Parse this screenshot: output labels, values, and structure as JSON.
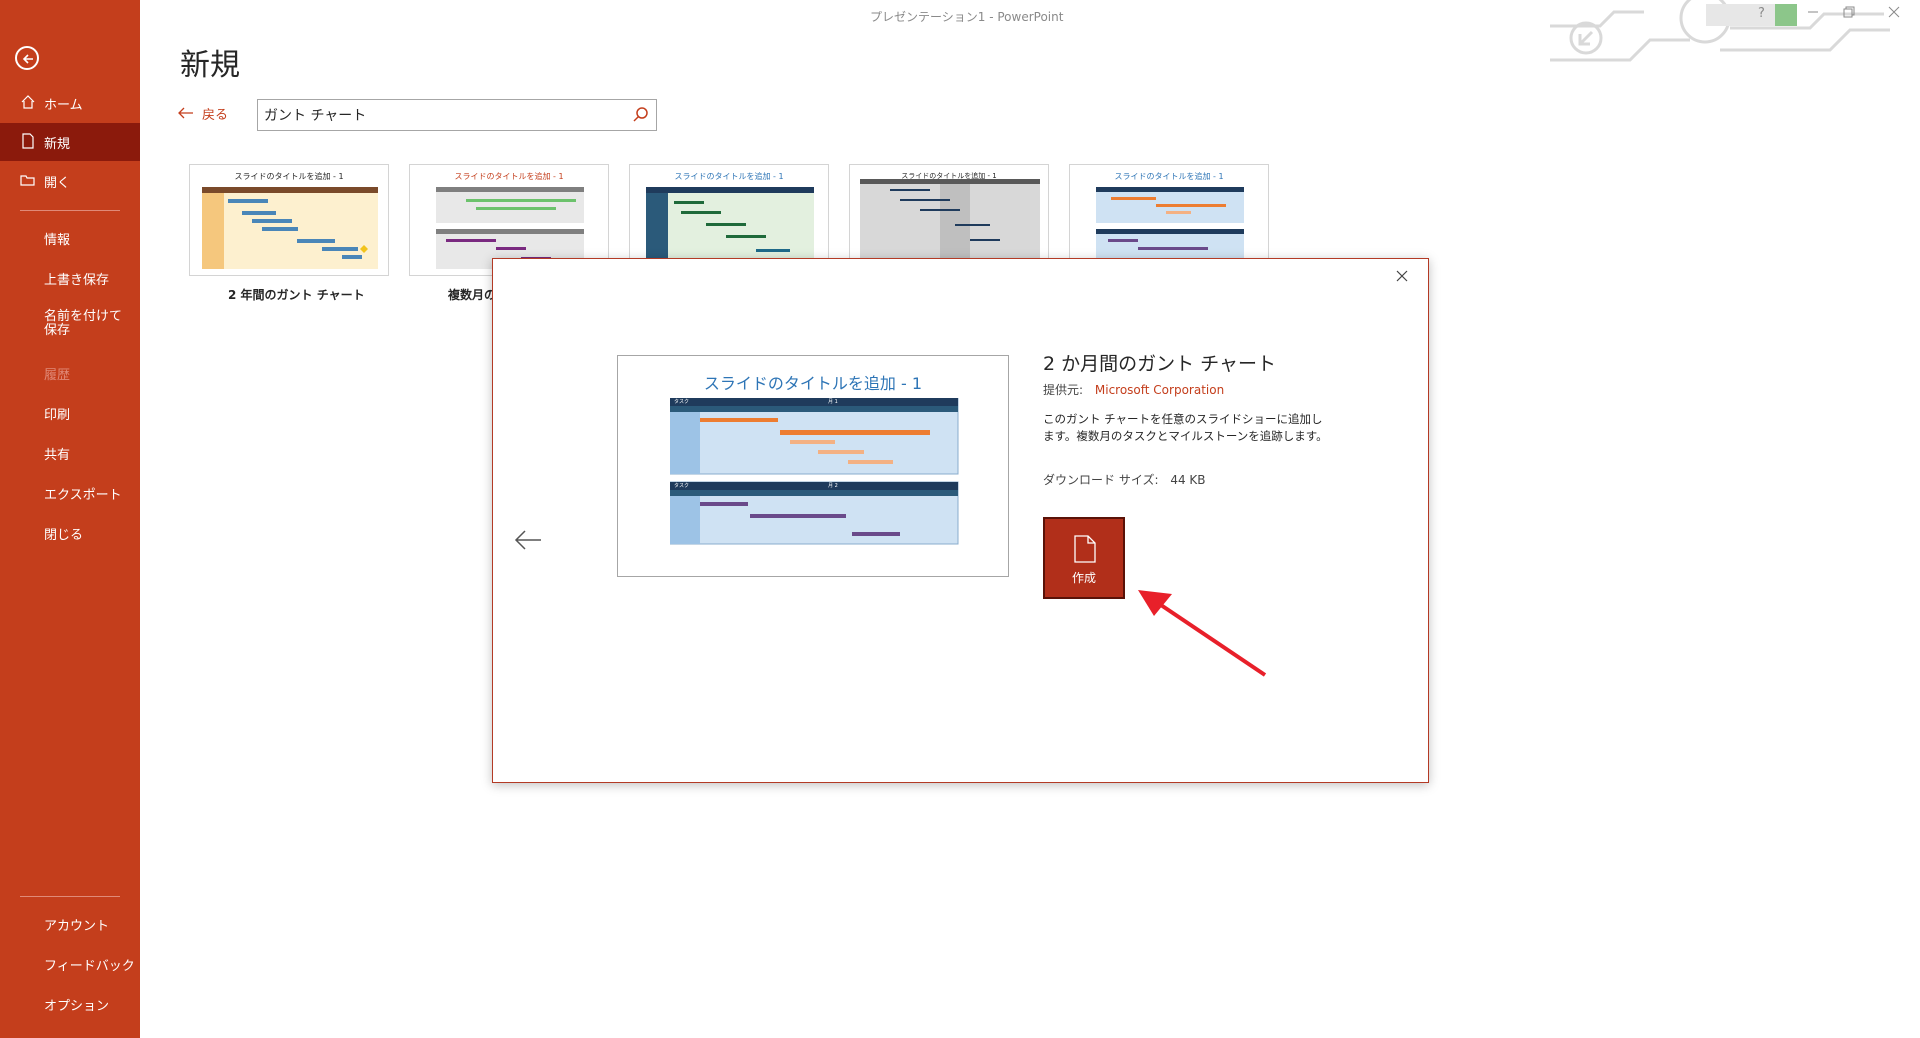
{
  "window": {
    "title": "プレゼンテーション1 - PowerPoint",
    "help": "?"
  },
  "sidebar": {
    "items": [
      {
        "label": "ホーム",
        "icon": "home-icon"
      },
      {
        "label": "新規",
        "icon": "new-file-icon",
        "active": true
      },
      {
        "label": "開く",
        "icon": "open-folder-icon"
      },
      {
        "label": "情報"
      },
      {
        "label": "上書き保存"
      },
      {
        "label": "名前を付けて保存"
      },
      {
        "label": "履歴",
        "disabled": true
      },
      {
        "label": "印刷"
      },
      {
        "label": "共有"
      },
      {
        "label": "エクスポート"
      },
      {
        "label": "閉じる"
      },
      {
        "label": "アカウント"
      },
      {
        "label": "フィードバック"
      },
      {
        "label": "オプション"
      }
    ],
    "colors": {
      "bg": "#c43e1c",
      "active": "#8b1a0c"
    }
  },
  "main": {
    "title": "新規",
    "back_label": "戻る",
    "search_value": "ガント チャート",
    "templates": [
      {
        "title": "スライドのタイトルを追加 - 1",
        "caption": "2 年間のガント チャート"
      },
      {
        "title": "スライドのタイトルを追加 - 1",
        "caption": "複数月の"
      },
      {
        "title": "スライドのタイトルを追加 - 1",
        "caption": ""
      },
      {
        "title": "スライドのタイトルを追加 - 1",
        "caption": ""
      },
      {
        "title": "スライドのタイトルを追加 - 1",
        "caption": ""
      }
    ]
  },
  "modal": {
    "preview_title": "スライドのタイトルを追加 - 1",
    "preview_header_task": "タスク",
    "preview_month1": "月 1",
    "preview_month2": "月 2",
    "title": "2 か月間のガント チャート",
    "provider_label": "提供元:",
    "provider_value": "Microsoft Corporation",
    "description": "このガント チャートを任意のスライドショーに追加します。複数月のタスクとマイルストーンを追跡します。",
    "download_label": "ダウンロード サイズ:",
    "download_value": "44 KB",
    "create_label": "作成"
  }
}
